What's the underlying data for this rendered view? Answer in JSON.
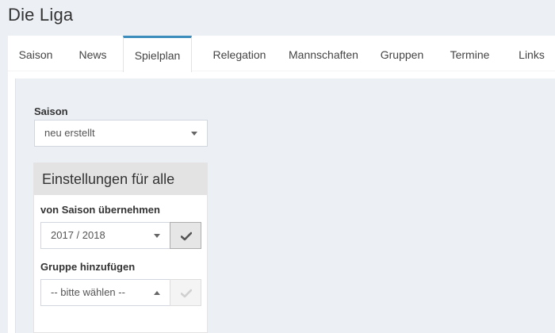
{
  "page": {
    "title": "Die Liga"
  },
  "tabs": [
    {
      "label": "Saison"
    },
    {
      "label": "News"
    },
    {
      "label": "Spielplan"
    },
    {
      "label": "Relegation"
    },
    {
      "label": "Mannschaften"
    },
    {
      "label": "Gruppen"
    },
    {
      "label": "Termine"
    },
    {
      "label": "Links"
    }
  ],
  "active_tab": "Spielplan",
  "saison": {
    "label": "Saison",
    "value": "neu erstellt"
  },
  "settings_panel": {
    "title": "Einstellungen für alle",
    "copy_from": {
      "label": "von Saison übernehmen",
      "value": "2017 / 2018"
    },
    "add_group": {
      "label": "Gruppe hinzufügen",
      "value": "-- bitte wählen --"
    }
  },
  "icons": {
    "confirm": "check-icon",
    "dropdown": "caret-down-icon",
    "dropdown_open": "caret-up-icon"
  },
  "colors": {
    "accent": "#3c8dbc",
    "background": "#ecf0f5",
    "panel_header": "#e3e3e3"
  }
}
